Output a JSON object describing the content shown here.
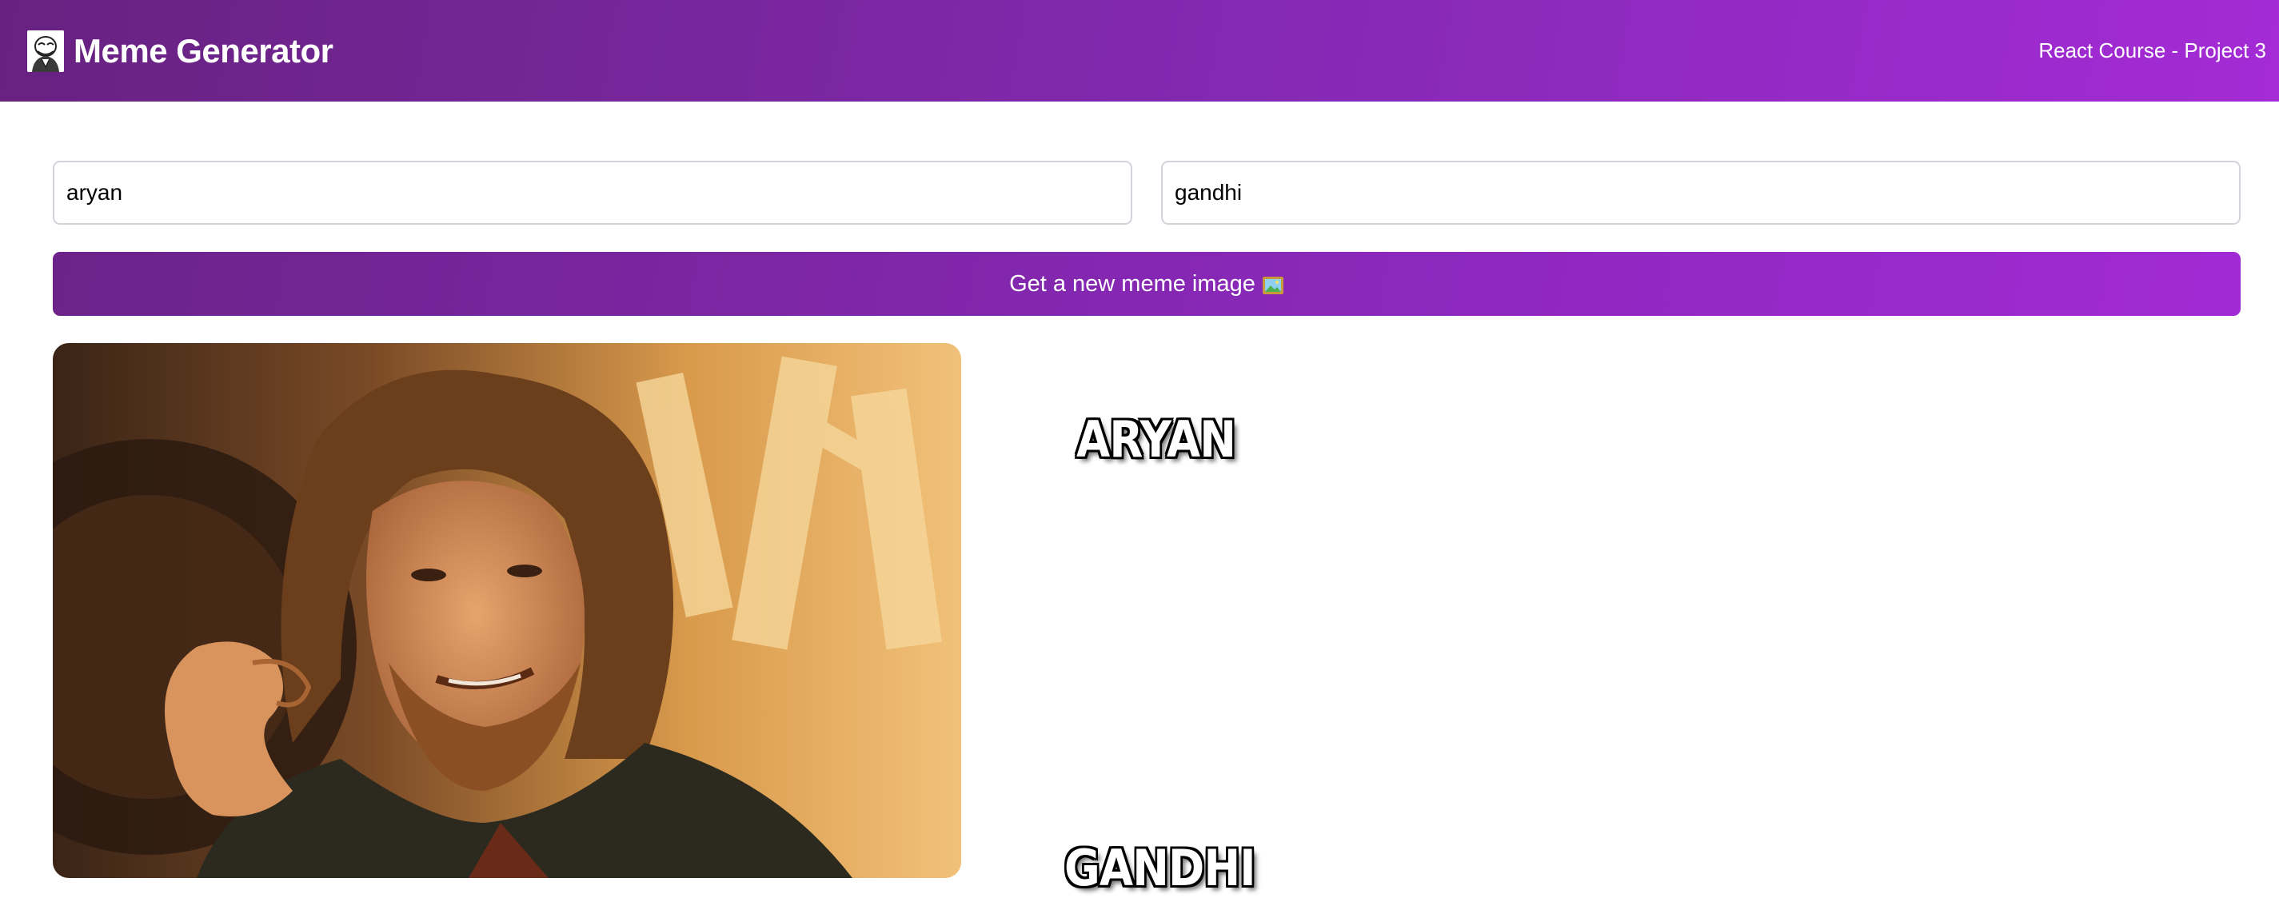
{
  "header": {
    "title": "Meme Generator",
    "project": "React Course - Project 3",
    "logo_icon": "troll-face-icon"
  },
  "form": {
    "top_text_value": "aryan",
    "bottom_text_value": "gandhi",
    "button_label": "Get a new meme image",
    "button_icon": "framed-picture-icon"
  },
  "meme": {
    "top_text": "ARYAN",
    "bottom_text": "GANDHI",
    "image_icon": "one-does-not-simply-meme-image"
  },
  "colors": {
    "brand_start": "#672280",
    "brand_end": "#a42bd6"
  }
}
